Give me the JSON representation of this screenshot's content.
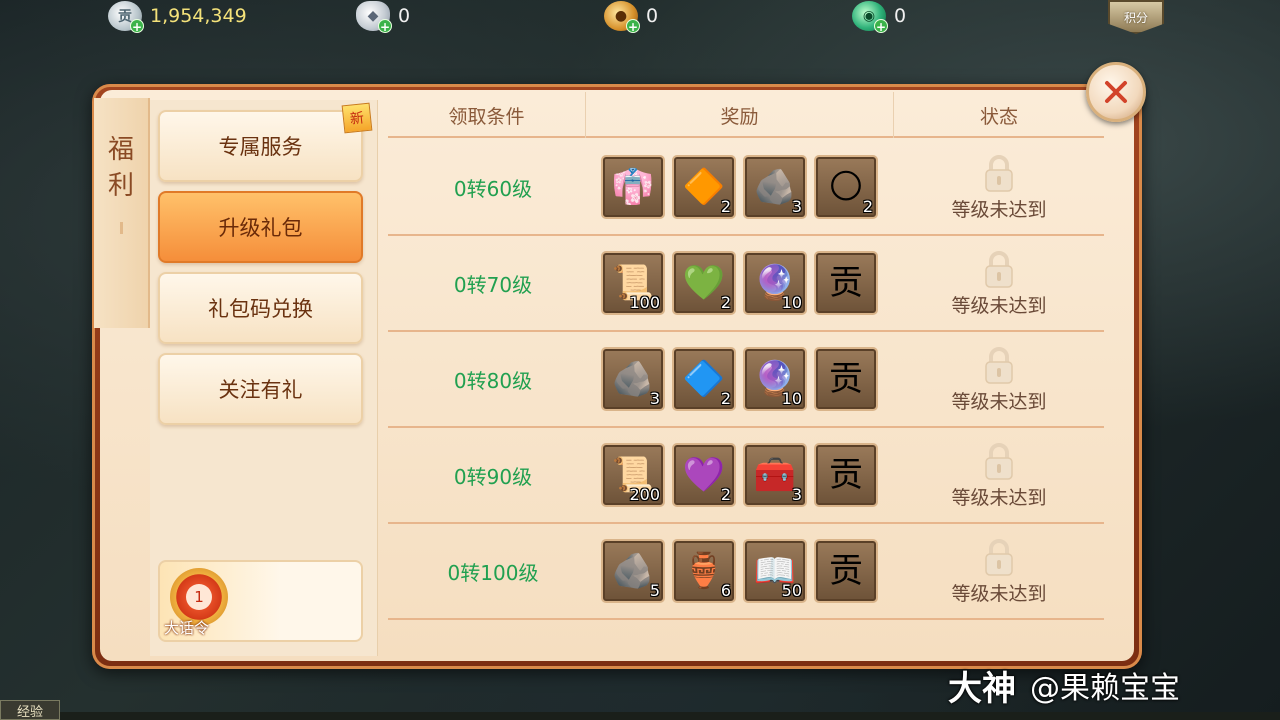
{
  "currencies": [
    {
      "name": "silver-coin",
      "icon": "silver-coin-icon",
      "glyph": "贡",
      "value": "1,954,349"
    },
    {
      "name": "silver-ingot",
      "icon": "silver-ingot-icon",
      "glyph": "◆",
      "value": "0"
    },
    {
      "name": "copper-coin",
      "icon": "copper-coin-icon",
      "glyph": "●",
      "value": "0"
    },
    {
      "name": "jade",
      "icon": "jade-icon",
      "glyph": "◉",
      "value": "0"
    }
  ],
  "points_label": "积分",
  "panel": {
    "title_chars": [
      "福",
      "利"
    ]
  },
  "menu": [
    {
      "label": "专属服务",
      "badge": "新",
      "active": false
    },
    {
      "label": "升级礼包",
      "active": true
    },
    {
      "label": "礼包码兑换",
      "active": false
    },
    {
      "label": "关注有礼",
      "active": false
    }
  ],
  "token": {
    "number": "1",
    "label": "大话令"
  },
  "table": {
    "headers": [
      "领取条件",
      "奖励",
      "状态"
    ],
    "rows": [
      {
        "condition": "0转60级",
        "status": "等级未达到",
        "rewards": [
          {
            "icon": "purple-outfit-icon",
            "glyph": "👘",
            "qty": ""
          },
          {
            "icon": "orange-gem-icon",
            "glyph": "🔶",
            "qty": "2"
          },
          {
            "icon": "dark-ore-icon",
            "glyph": "🪨",
            "qty": "3"
          },
          {
            "icon": "gold-orb-icon",
            "glyph": "🌕",
            "qty": "2"
          }
        ]
      },
      {
        "condition": "0转70级",
        "status": "等级未达到",
        "rewards": [
          {
            "icon": "scroll-icon",
            "glyph": "📜",
            "qty": "100"
          },
          {
            "icon": "green-gem-icon",
            "glyph": "💚",
            "qty": "2"
          },
          {
            "icon": "purple-crystal-ball-icon",
            "glyph": "🔮",
            "qty": "10"
          },
          {
            "icon": "silver-coin-icon",
            "glyph": "贡",
            "qty": ""
          }
        ]
      },
      {
        "condition": "0转80级",
        "status": "等级未达到",
        "rewards": [
          {
            "icon": "dark-ore-icon",
            "glyph": "🪨",
            "qty": "3"
          },
          {
            "icon": "blue-gem-icon",
            "glyph": "🔷",
            "qty": "2"
          },
          {
            "icon": "purple-crystal-ball-icon",
            "glyph": "🔮",
            "qty": "10"
          },
          {
            "icon": "silver-coin-icon",
            "glyph": "贡",
            "qty": ""
          }
        ]
      },
      {
        "condition": "0转90级",
        "status": "等级未达到",
        "rewards": [
          {
            "icon": "scroll-icon",
            "glyph": "📜",
            "qty": "200"
          },
          {
            "icon": "purple-gem-icon",
            "glyph": "💜",
            "qty": "2"
          },
          {
            "icon": "treasure-chest-icon",
            "glyph": "🧰",
            "qty": "3"
          },
          {
            "icon": "silver-coin-icon",
            "glyph": "贡",
            "qty": ""
          }
        ]
      },
      {
        "condition": "0转100级",
        "status": "等级未达到",
        "rewards": [
          {
            "icon": "dark-ore-icon",
            "glyph": "🪨",
            "qty": "5"
          },
          {
            "icon": "vase-icon",
            "glyph": "🏺",
            "qty": "6"
          },
          {
            "icon": "book-icon",
            "glyph": "📖",
            "qty": "50"
          },
          {
            "icon": "silver-coin-icon",
            "glyph": "贡",
            "qty": ""
          }
        ]
      }
    ]
  },
  "watermark": {
    "brand": "大神",
    "user": "@果赖宝宝"
  },
  "exp_label": "经验",
  "colors": {
    "condition_text": "#21a050",
    "frame": "#a3451f",
    "active_tab": "#f58e3a"
  }
}
